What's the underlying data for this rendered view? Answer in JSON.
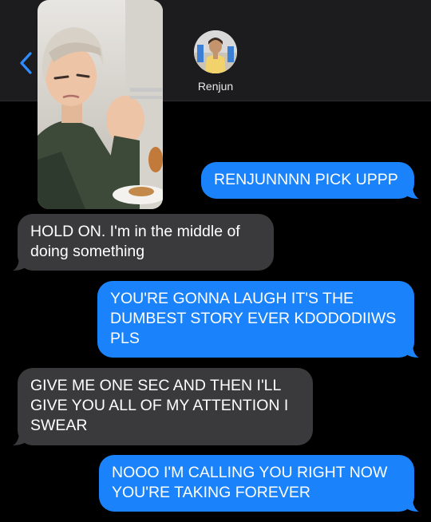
{
  "contact": {
    "name": "Renjun"
  },
  "messages": [
    {
      "direction": "outgoing",
      "lines": [
        "RENJUNNNN PICK UPPP"
      ]
    },
    {
      "direction": "incoming",
      "lines": [
        "HOLD ON. I'm in the middle of",
        "doing something"
      ]
    },
    {
      "direction": "outgoing",
      "lines": [
        "YOU'RE GONNA LAUGH IT'S THE",
        "DUMBEST STORY EVER KDODODIIWS",
        "PLS"
      ]
    },
    {
      "direction": "incoming",
      "lines": [
        "GIVE ME ONE SEC AND THEN I'LL",
        "GIVE YOU ALL OF MY ATTENTION I",
        "SWEAR"
      ]
    },
    {
      "direction": "outgoing",
      "lines": [
        "NOOO I'M CALLING YOU RIGHT NOW",
        "YOU'RE TAKING FOREVER"
      ]
    }
  ],
  "colors": {
    "outgoing_bubble": "#1a82fb",
    "incoming_bubble": "#3a3a3c",
    "header_bg": "#1c1c1e",
    "back_arrow": "#2f8cff"
  },
  "icons": {
    "back": "chevron-left-icon"
  }
}
